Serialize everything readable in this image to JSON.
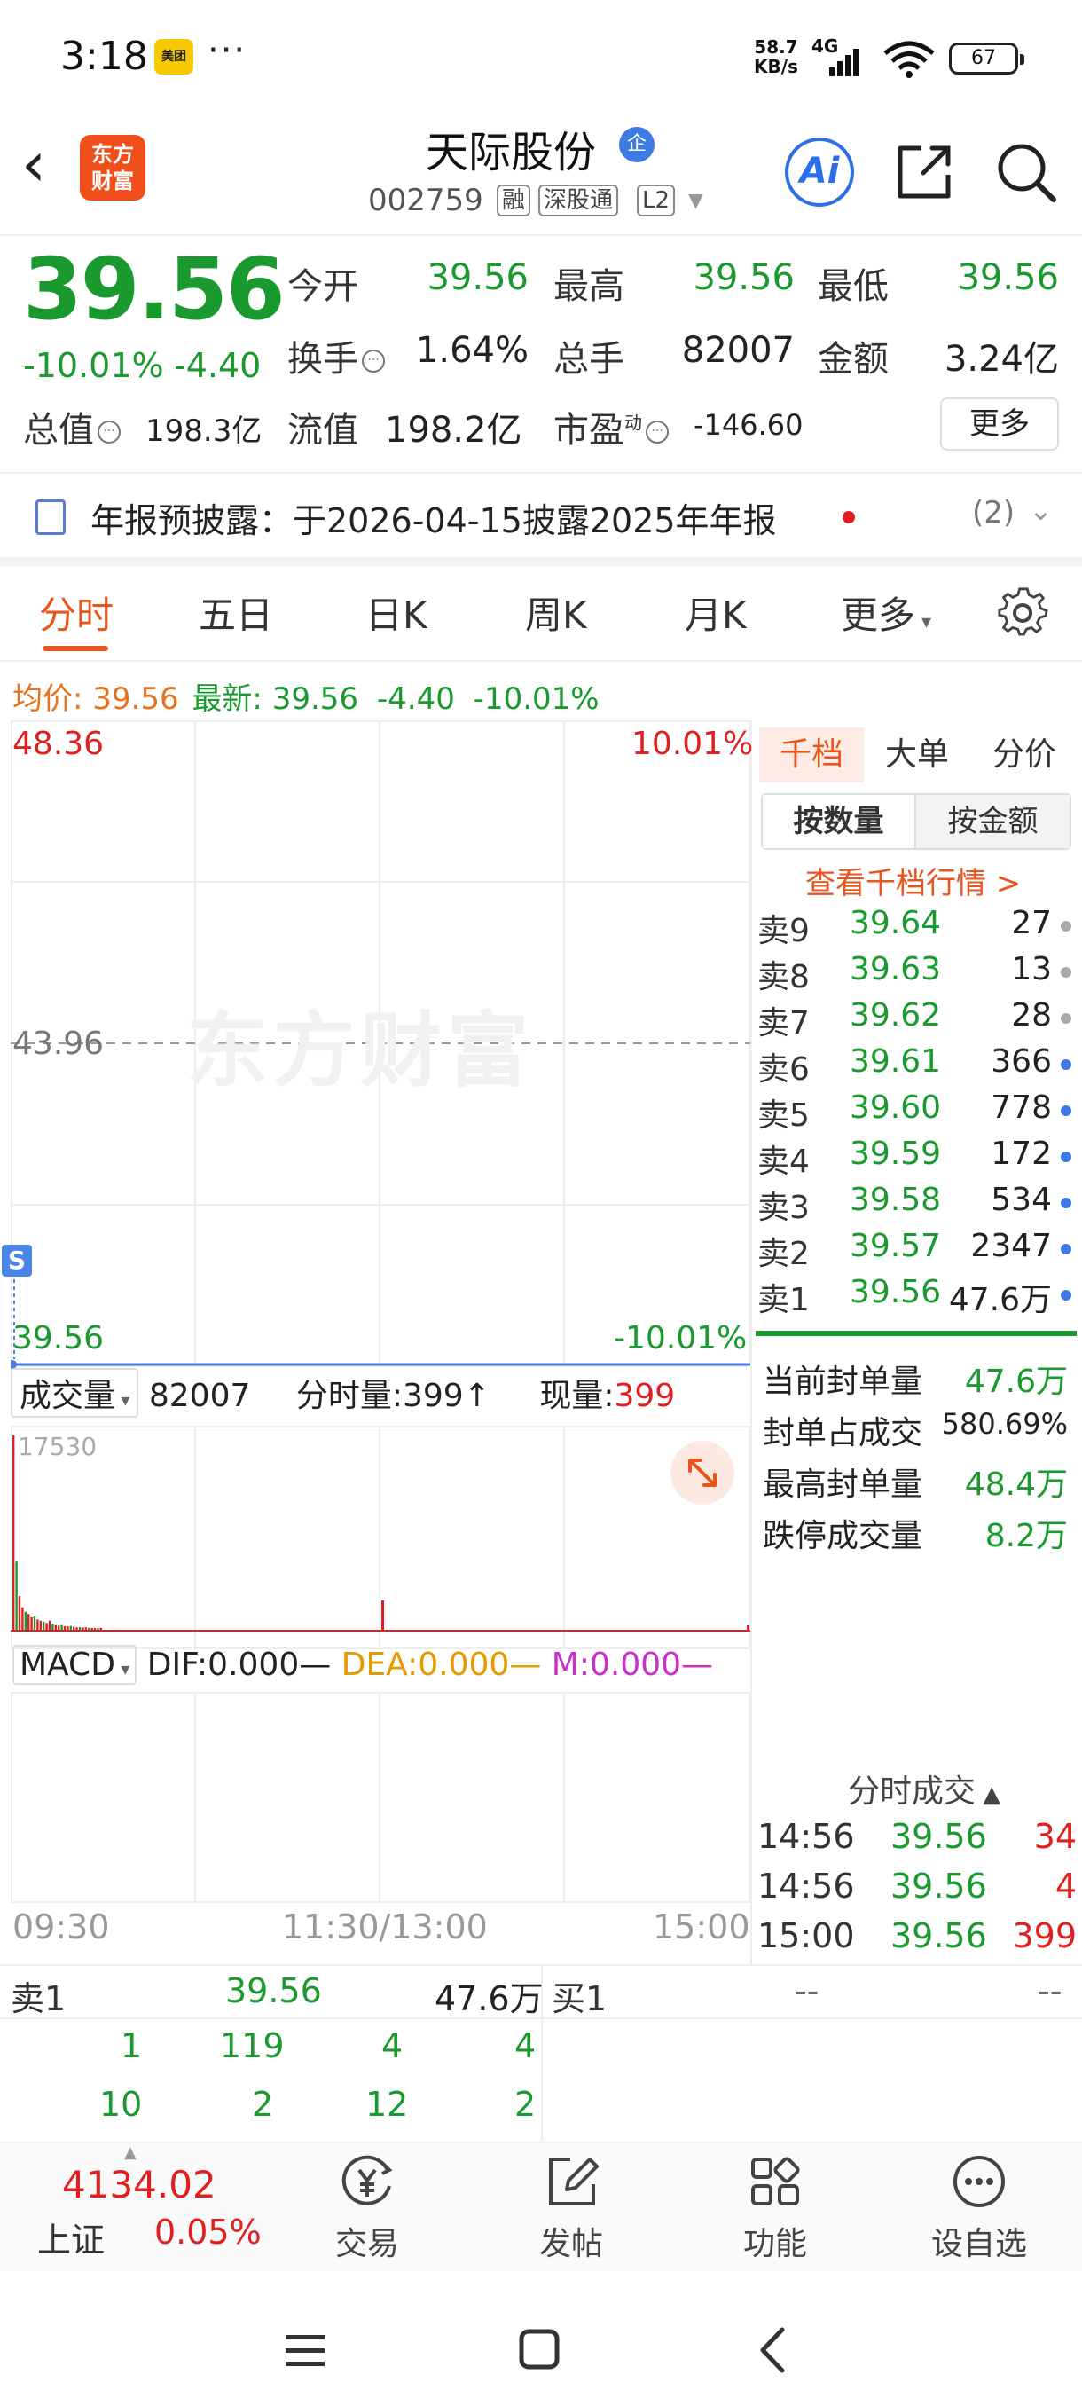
{
  "status": {
    "time": "3:18",
    "badge": "美团",
    "more": "···",
    "speed_top": "58.7",
    "speed_unit": "KB/s",
    "net": "4G",
    "battery": "67"
  },
  "header": {
    "logo_line1": "东方",
    "logo_line2": "财富",
    "name": "天际股份",
    "corp_badge": "企",
    "code": "002759",
    "tags": [
      "融",
      "深股通",
      "L2"
    ],
    "ai": "Ai"
  },
  "quote": {
    "price": "39.56",
    "pct": "-10.01%",
    "chg": "-4.40",
    "rows": [
      [
        {
          "l": "今开",
          "v": "39.56",
          "c": "g"
        },
        {
          "l": "最高",
          "v": "39.56",
          "c": "g"
        },
        {
          "l": "最低",
          "v": "39.56",
          "c": "g"
        }
      ],
      [
        {
          "l": "换手",
          "v": "1.64%",
          "c": "k"
        },
        {
          "l": "总手",
          "v": "82007",
          "c": "k"
        },
        {
          "l": "金额",
          "v": "3.24亿",
          "c": "k"
        }
      ]
    ],
    "total_value_label": "总值",
    "total_value": "198.3亿",
    "float_label": "流值",
    "float_value": "198.2亿",
    "pe_label": "市盈",
    "pe_sup": "动",
    "pe_value": "-146.60",
    "more": "更多"
  },
  "announcement": {
    "text": "年报预披露：于2026-04-15披露2025年年报",
    "count": "(2)"
  },
  "tabs": [
    "分时",
    "五日",
    "日K",
    "周K",
    "月K",
    "更多"
  ],
  "avg": {
    "label": "均价:",
    "value": "39.56",
    "latest_label": "最新:",
    "latest": "39.56",
    "chg": "-4.40",
    "pct": "-10.01%"
  },
  "chart": {
    "top_price": "48.36",
    "top_pct": "10.01%",
    "mid_price": "43.96",
    "bottom_price": "39.56",
    "bottom_pct": "-10.01%",
    "watermark": "东方财富",
    "s_badge": "S",
    "volume_label": "成交量",
    "volume_total": "82007",
    "minute_vol_label": "分时量:",
    "minute_vol": "399",
    "minute_vol_arrow": "↑",
    "now_vol_label": "现量:",
    "now_vol": "399",
    "vol_max": "17530",
    "macd_label": "MACD",
    "dif": "DIF:0.000—",
    "dea": "DEA:0.000—",
    "m": "M:0.000—",
    "time_start": "09:30",
    "time_mid": "11:30/13:00",
    "time_end": "15:00"
  },
  "orderbook": {
    "tabs": [
      "千档",
      "大单",
      "分价"
    ],
    "seg": [
      "按数量",
      "按金额"
    ],
    "link": "查看千档行情 >",
    "rows": [
      {
        "l": "卖9",
        "p": "39.64",
        "v": "27",
        "dot": "#aaaaaa"
      },
      {
        "l": "卖8",
        "p": "39.63",
        "v": "13",
        "dot": "#aaaaaa"
      },
      {
        "l": "卖7",
        "p": "39.62",
        "v": "28",
        "dot": "#aaaaaa"
      },
      {
        "l": "卖6",
        "p": "39.61",
        "v": "366",
        "dot": "#3d7be0"
      },
      {
        "l": "卖5",
        "p": "39.60",
        "v": "778",
        "dot": "#3d7be0"
      },
      {
        "l": "卖4",
        "p": "39.59",
        "v": "172",
        "dot": "#3d7be0"
      },
      {
        "l": "卖3",
        "p": "39.58",
        "v": "534",
        "dot": "#3d7be0"
      },
      {
        "l": "卖2",
        "p": "39.57",
        "v": "2347",
        "dot": "#3d7be0"
      },
      {
        "l": "卖1",
        "p": "39.56",
        "v": "47.6万",
        "dot": "#3d7be0"
      }
    ],
    "stats": [
      {
        "l": "当前封单量",
        "v": "47.6万",
        "c": "g"
      },
      {
        "l": "封单占成交",
        "v": "580.69%",
        "c": "k"
      },
      {
        "l": "最高封单量",
        "v": "48.4万",
        "c": "g"
      },
      {
        "l": "跌停成交量",
        "v": "8.2万",
        "c": "g"
      }
    ],
    "deals_head": "分时成交",
    "deals": [
      {
        "t": "14:56",
        "p": "39.56",
        "q": "34"
      },
      {
        "t": "14:56",
        "p": "39.56",
        "q": "4"
      },
      {
        "t": "15:00",
        "p": "39.56",
        "q": "399"
      }
    ]
  },
  "bottom_quote": {
    "sell_label": "卖1",
    "sell_price": "39.56",
    "sell_vol": "47.6万",
    "buy_label": "买1",
    "buy_price": "--",
    "buy_vol": "--",
    "row1": [
      "1",
      "119",
      "4",
      "4"
    ],
    "row2": [
      "10",
      "2",
      "12",
      "2"
    ]
  },
  "nav": {
    "index_value": "4134.02",
    "index_name": "上证",
    "index_pct": "0.05%",
    "items": [
      "交易",
      "发帖",
      "功能",
      "设自选"
    ]
  },
  "volume_bars": [
    17530,
    6200,
    3100,
    2100,
    1700,
    1500,
    1200,
    1300,
    1000,
    900,
    800,
    700,
    900,
    600,
    500,
    450,
    500,
    400,
    380,
    420,
    350,
    300,
    320,
    280,
    300,
    260,
    250,
    240,
    230,
    260
  ]
}
